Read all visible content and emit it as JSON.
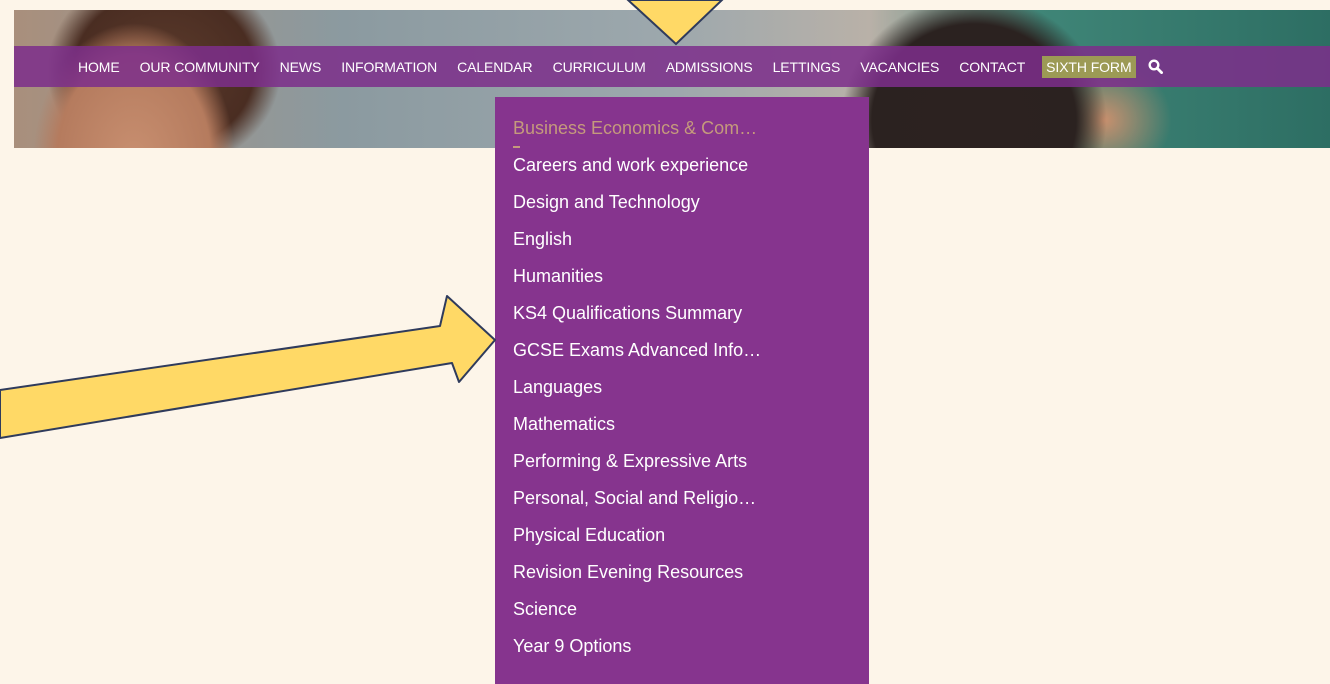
{
  "nav": {
    "items": [
      {
        "label": "HOME"
      },
      {
        "label": "OUR COMMUNITY"
      },
      {
        "label": "NEWS"
      },
      {
        "label": "INFORMATION"
      },
      {
        "label": "CALENDAR"
      },
      {
        "label": "CURRICULUM"
      },
      {
        "label": "ADMISSIONS"
      },
      {
        "label": "LETTINGS"
      },
      {
        "label": "VACANCIES"
      },
      {
        "label": "CONTACT"
      },
      {
        "label": "SIXTH FORM"
      }
    ],
    "search_icon": "search-icon"
  },
  "dropdown": {
    "items": [
      {
        "label": "Business Economics & Com…"
      },
      {
        "label": "Careers and work experience"
      },
      {
        "label": "Design and Technology"
      },
      {
        "label": "English"
      },
      {
        "label": "Humanities"
      },
      {
        "label": "KS4 Qualifications Summary"
      },
      {
        "label": "GCSE Exams Advanced Info…"
      },
      {
        "label": "Languages"
      },
      {
        "label": "Mathematics"
      },
      {
        "label": "Performing & Expressive Arts"
      },
      {
        "label": "Personal, Social and Religio…"
      },
      {
        "label": "Physical Education"
      },
      {
        "label": "Revision Evening Resources"
      },
      {
        "label": "Science"
      },
      {
        "label": "Year 9 Options"
      }
    ]
  },
  "colors": {
    "page_bg": "#fdf5e9",
    "nav_bg": "#7d2f8a",
    "dropdown_bg": "#86348e",
    "active_item": "#c59a7c",
    "sixth_form_bg": "#9c9a55",
    "arrow_fill": "#ffd966",
    "arrow_stroke": "#2f3b5c"
  }
}
